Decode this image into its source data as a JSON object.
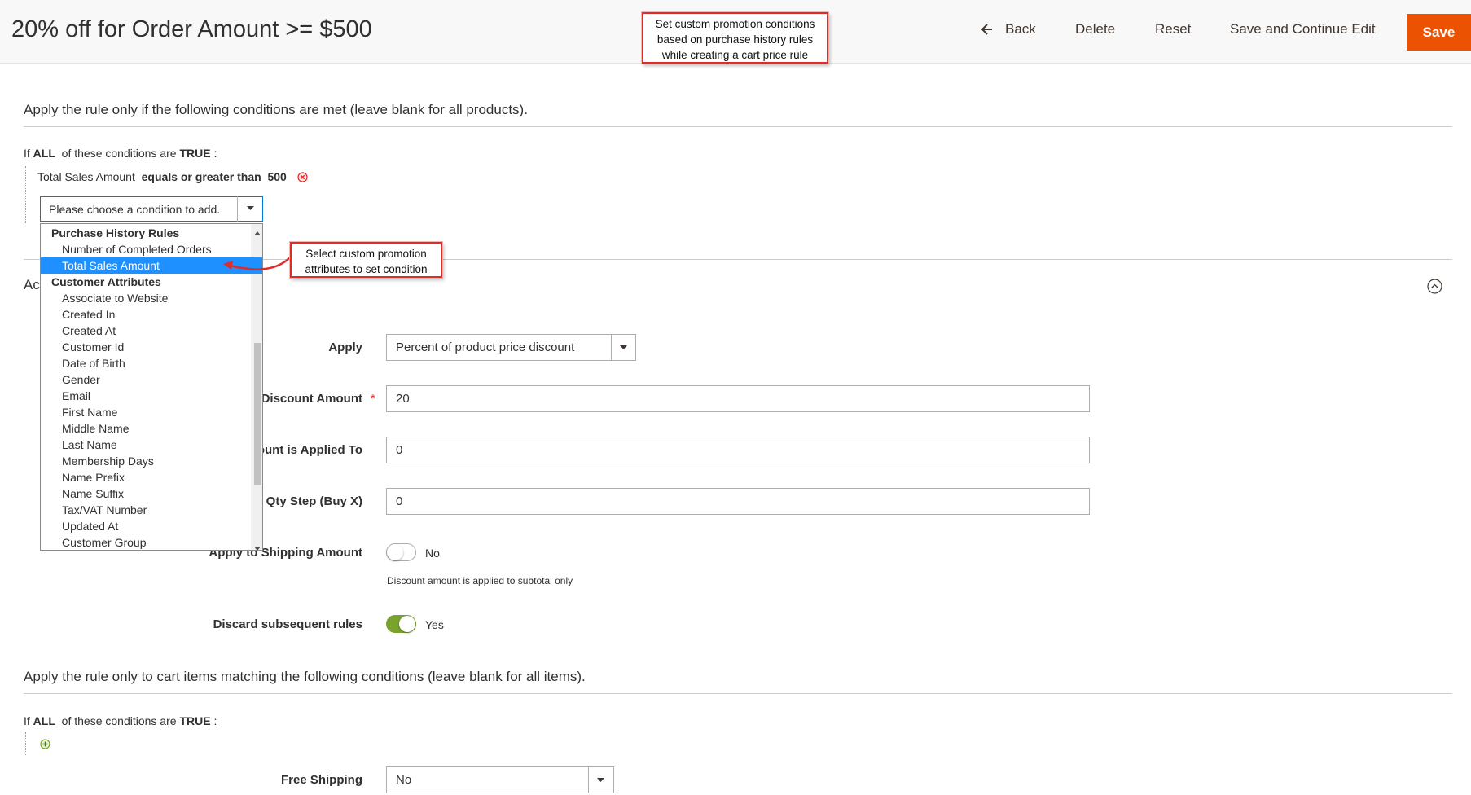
{
  "header": {
    "title": "20% off for Order Amount >= $500",
    "buttons": {
      "back": "Back",
      "delete": "Delete",
      "reset": "Reset",
      "save_continue": "Save and Continue Edit",
      "save": "Save"
    }
  },
  "callouts": {
    "top": [
      "Set custom promotion conditions",
      "based on purchase history rules",
      "while creating a cart price rule"
    ],
    "select": [
      "Select custom promotion",
      "attributes to set condition"
    ]
  },
  "conditions": {
    "heading": "Apply the rule only if the following conditions are met (leave blank for all products).",
    "if_prefix": "If",
    "aggregator": "ALL",
    "mid_text": "of these conditions are",
    "value": "TRUE",
    "suffix": ":",
    "rule": {
      "attribute": "Total Sales Amount",
      "operator": "equals or greater than",
      "value": "500"
    },
    "select_placeholder": "Please choose a condition to add.",
    "options": [
      {
        "label": "Purchase History Rules",
        "group": true
      },
      {
        "label": "Number of Completed Orders"
      },
      {
        "label": "Total Sales Amount",
        "selected": true
      },
      {
        "label": "Customer Attributes",
        "group": true
      },
      {
        "label": "Associate to Website"
      },
      {
        "label": "Created In"
      },
      {
        "label": "Created At"
      },
      {
        "label": "Customer Id"
      },
      {
        "label": "Date of Birth"
      },
      {
        "label": "Gender"
      },
      {
        "label": "Email"
      },
      {
        "label": "First Name"
      },
      {
        "label": "Middle Name"
      },
      {
        "label": "Last Name"
      },
      {
        "label": "Membership Days"
      },
      {
        "label": "Name Prefix"
      },
      {
        "label": "Name Suffix"
      },
      {
        "label": "Tax/VAT Number"
      },
      {
        "label": "Updated At"
      },
      {
        "label": "Customer Group"
      }
    ]
  },
  "actions": {
    "heading_partial": "Ac",
    "apply_label": "Apply",
    "apply_value": "Percent of product price discount",
    "discount_amount_label": "Discount Amount",
    "required_mark": "*",
    "discount_amount_value": "20",
    "max_qty_label": "ount is Applied To",
    "max_qty_value": "0",
    "qty_step_label": "nt Qty Step (Buy X)",
    "qty_step_value": "0",
    "shipping_label": "Apply to Shipping Amount",
    "shipping_value": "No",
    "shipping_note": "Discount amount is applied to subtotal only",
    "discard_label": "Discard subsequent rules",
    "discard_value": "Yes"
  },
  "cart_conditions": {
    "heading": "Apply the rule only to cart items matching the following conditions (leave blank for all items).",
    "if_prefix": "If",
    "aggregator": "ALL",
    "mid_text": "of these conditions are",
    "value": "TRUE",
    "suffix": ":",
    "free_shipping_label": "Free Shipping",
    "free_shipping_value": "No"
  },
  "colors": {
    "accent": "#eb5202",
    "select_highlight": "#1e90ff",
    "toggle_on": "#79a22e",
    "callout_border": "#e02b27",
    "remove_icon": "#e22626",
    "add_icon": "#79a22e"
  },
  "icons": {
    "back": "arrow-left-icon",
    "remove": "remove-condition-icon",
    "add": "add-condition-icon",
    "collapse": "collapse-icon",
    "dropdown": "chevron-down-icon"
  }
}
